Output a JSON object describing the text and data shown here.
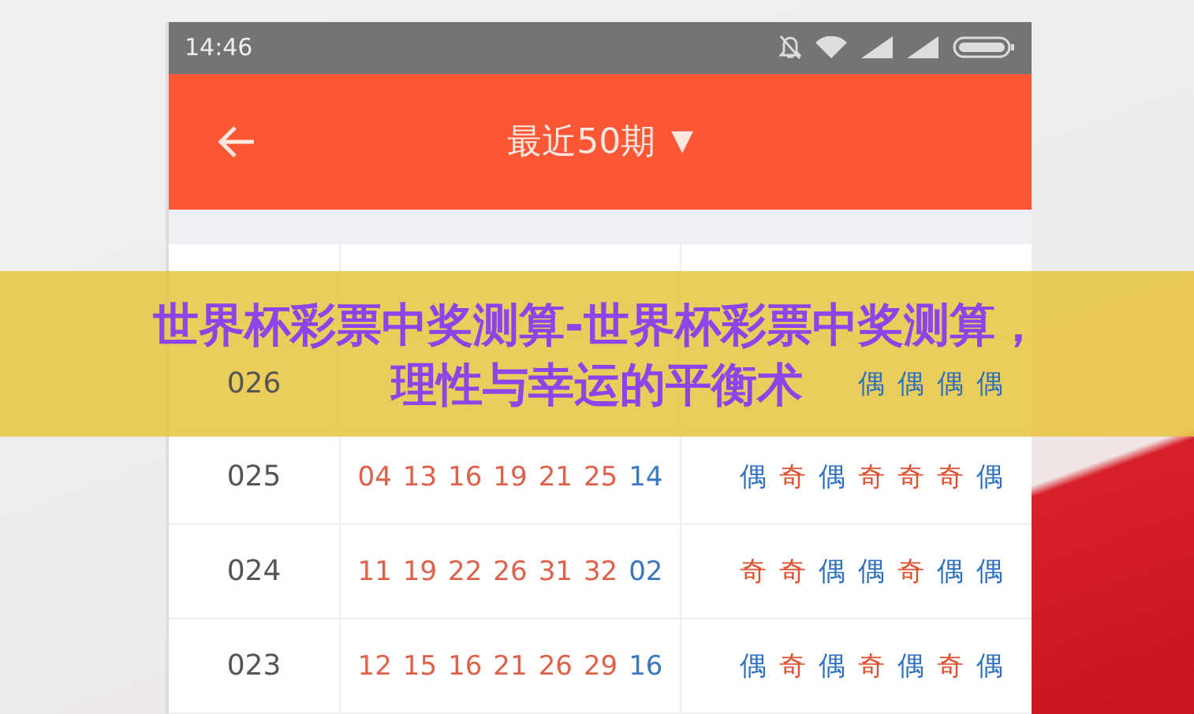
{
  "status_bar": {
    "time": "14:46"
  },
  "app_bar": {
    "title": "最近50期",
    "dropdown_arrow": "▼"
  },
  "rows": [
    {
      "period": "026",
      "numbers": [],
      "parity": [
        {
          "label": "偶",
          "kind": "even"
        },
        {
          "label": "偶",
          "kind": "even"
        },
        {
          "label": "偶",
          "kind": "even"
        },
        {
          "label": "偶",
          "kind": "even"
        }
      ]
    },
    {
      "period": "025",
      "numbers": [
        {
          "value": "04",
          "kind": "red"
        },
        {
          "value": "13",
          "kind": "red"
        },
        {
          "value": "16",
          "kind": "red"
        },
        {
          "value": "19",
          "kind": "red"
        },
        {
          "value": "21",
          "kind": "red"
        },
        {
          "value": "25",
          "kind": "red"
        },
        {
          "value": "14",
          "kind": "blue"
        }
      ],
      "parity": [
        {
          "label": "偶",
          "kind": "even"
        },
        {
          "label": "奇",
          "kind": "odd"
        },
        {
          "label": "偶",
          "kind": "even"
        },
        {
          "label": "奇",
          "kind": "odd"
        },
        {
          "label": "奇",
          "kind": "odd"
        },
        {
          "label": "奇",
          "kind": "odd"
        },
        {
          "label": "偶",
          "kind": "even"
        }
      ]
    },
    {
      "period": "024",
      "numbers": [
        {
          "value": "11",
          "kind": "red"
        },
        {
          "value": "19",
          "kind": "red"
        },
        {
          "value": "22",
          "kind": "red"
        },
        {
          "value": "26",
          "kind": "red"
        },
        {
          "value": "31",
          "kind": "red"
        },
        {
          "value": "32",
          "kind": "red"
        },
        {
          "value": "02",
          "kind": "blue"
        }
      ],
      "parity": [
        {
          "label": "奇",
          "kind": "odd"
        },
        {
          "label": "奇",
          "kind": "odd"
        },
        {
          "label": "偶",
          "kind": "even"
        },
        {
          "label": "偶",
          "kind": "even"
        },
        {
          "label": "奇",
          "kind": "odd"
        },
        {
          "label": "偶",
          "kind": "even"
        },
        {
          "label": "偶",
          "kind": "even"
        }
      ]
    },
    {
      "period": "023",
      "numbers": [
        {
          "value": "12",
          "kind": "red"
        },
        {
          "value": "15",
          "kind": "red"
        },
        {
          "value": "16",
          "kind": "red"
        },
        {
          "value": "21",
          "kind": "red"
        },
        {
          "value": "26",
          "kind": "red"
        },
        {
          "value": "29",
          "kind": "red"
        },
        {
          "value": "16",
          "kind": "blue"
        }
      ],
      "parity": [
        {
          "label": "偶",
          "kind": "even"
        },
        {
          "label": "奇",
          "kind": "odd"
        },
        {
          "label": "偶",
          "kind": "even"
        },
        {
          "label": "奇",
          "kind": "odd"
        },
        {
          "label": "偶",
          "kind": "even"
        },
        {
          "label": "奇",
          "kind": "odd"
        },
        {
          "label": "偶",
          "kind": "even"
        }
      ]
    }
  ],
  "banner": {
    "lines": [
      "世界杯彩票中奖测算-世界杯彩票中奖测算，",
      "理性与幸运的平衡术"
    ]
  }
}
